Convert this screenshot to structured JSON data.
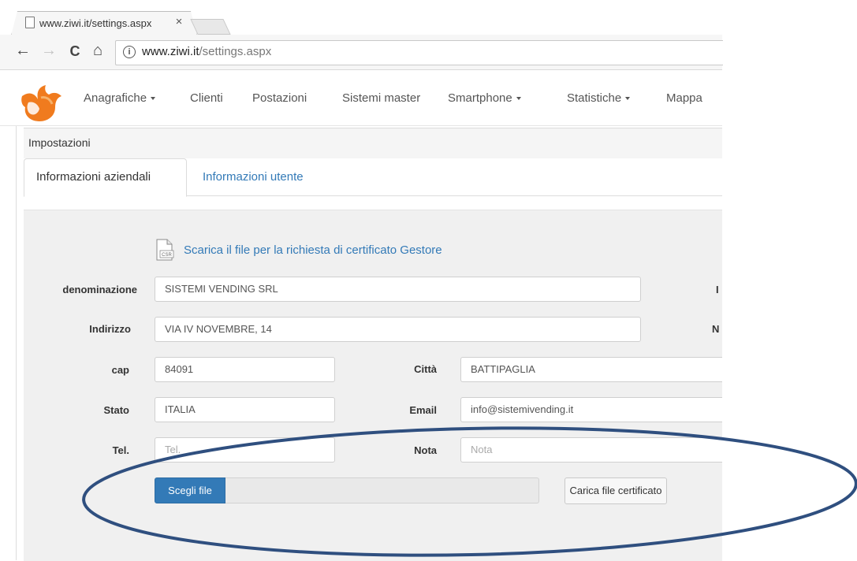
{
  "browser": {
    "tab_title": "www.ziwi.it/settings.aspx",
    "tab_close": "×",
    "url_host": "www.ziwi.it",
    "url_path": "/settings.aspx",
    "info_glyph": "i",
    "back_glyph": "←",
    "forward_glyph": "→",
    "reload_glyph": "C",
    "home_glyph": "⌂"
  },
  "navbar": {
    "items": [
      {
        "label": "Anagrafiche",
        "dropdown": true
      },
      {
        "label": "Clienti",
        "dropdown": false
      },
      {
        "label": "Postazioni",
        "dropdown": false
      },
      {
        "label": "Sistemi master",
        "dropdown": false
      },
      {
        "label": "Smartphone",
        "dropdown": true
      },
      {
        "label": "Statistiche",
        "dropdown": true
      },
      {
        "label": "Mappa",
        "dropdown": false
      }
    ],
    "logo_colors": {
      "orange": "#f07b1e",
      "light": "#f6b26b"
    }
  },
  "panel": {
    "title": "Impostazioni",
    "tabs": [
      {
        "label": "Informazioni aziendali",
        "active": true
      },
      {
        "label": "Informazioni utente",
        "active": false
      }
    ]
  },
  "form": {
    "csr_icon_text": "CSR",
    "csr_link": "Scarica il file per la richiesta di certificato Gestore",
    "denominazione": {
      "label": "denominazione",
      "value": "SISTEMI VENDING SRL"
    },
    "indirizzo": {
      "label": "Indirizzo",
      "value": "VIA IV NOVEMBRE, 14"
    },
    "cap": {
      "label": "cap",
      "value": "84091"
    },
    "citta": {
      "label": "Città",
      "value": "BATTIPAGLIA"
    },
    "stato": {
      "label": "Stato",
      "value": "ITALIA"
    },
    "email": {
      "label": "Email",
      "value": "info@sistemivending.it"
    },
    "tel": {
      "label": "Tel.",
      "placeholder": "Tel."
    },
    "nota": {
      "label": "Nota",
      "placeholder": "Nota"
    },
    "right_edge_chars": [
      "I",
      "N"
    ],
    "choose_file_button": "Scegli file",
    "upload_button": "Carica file certificato"
  },
  "colors": {
    "link_blue": "#337ab7",
    "annotation_ellipse": "#2f4f7f"
  }
}
